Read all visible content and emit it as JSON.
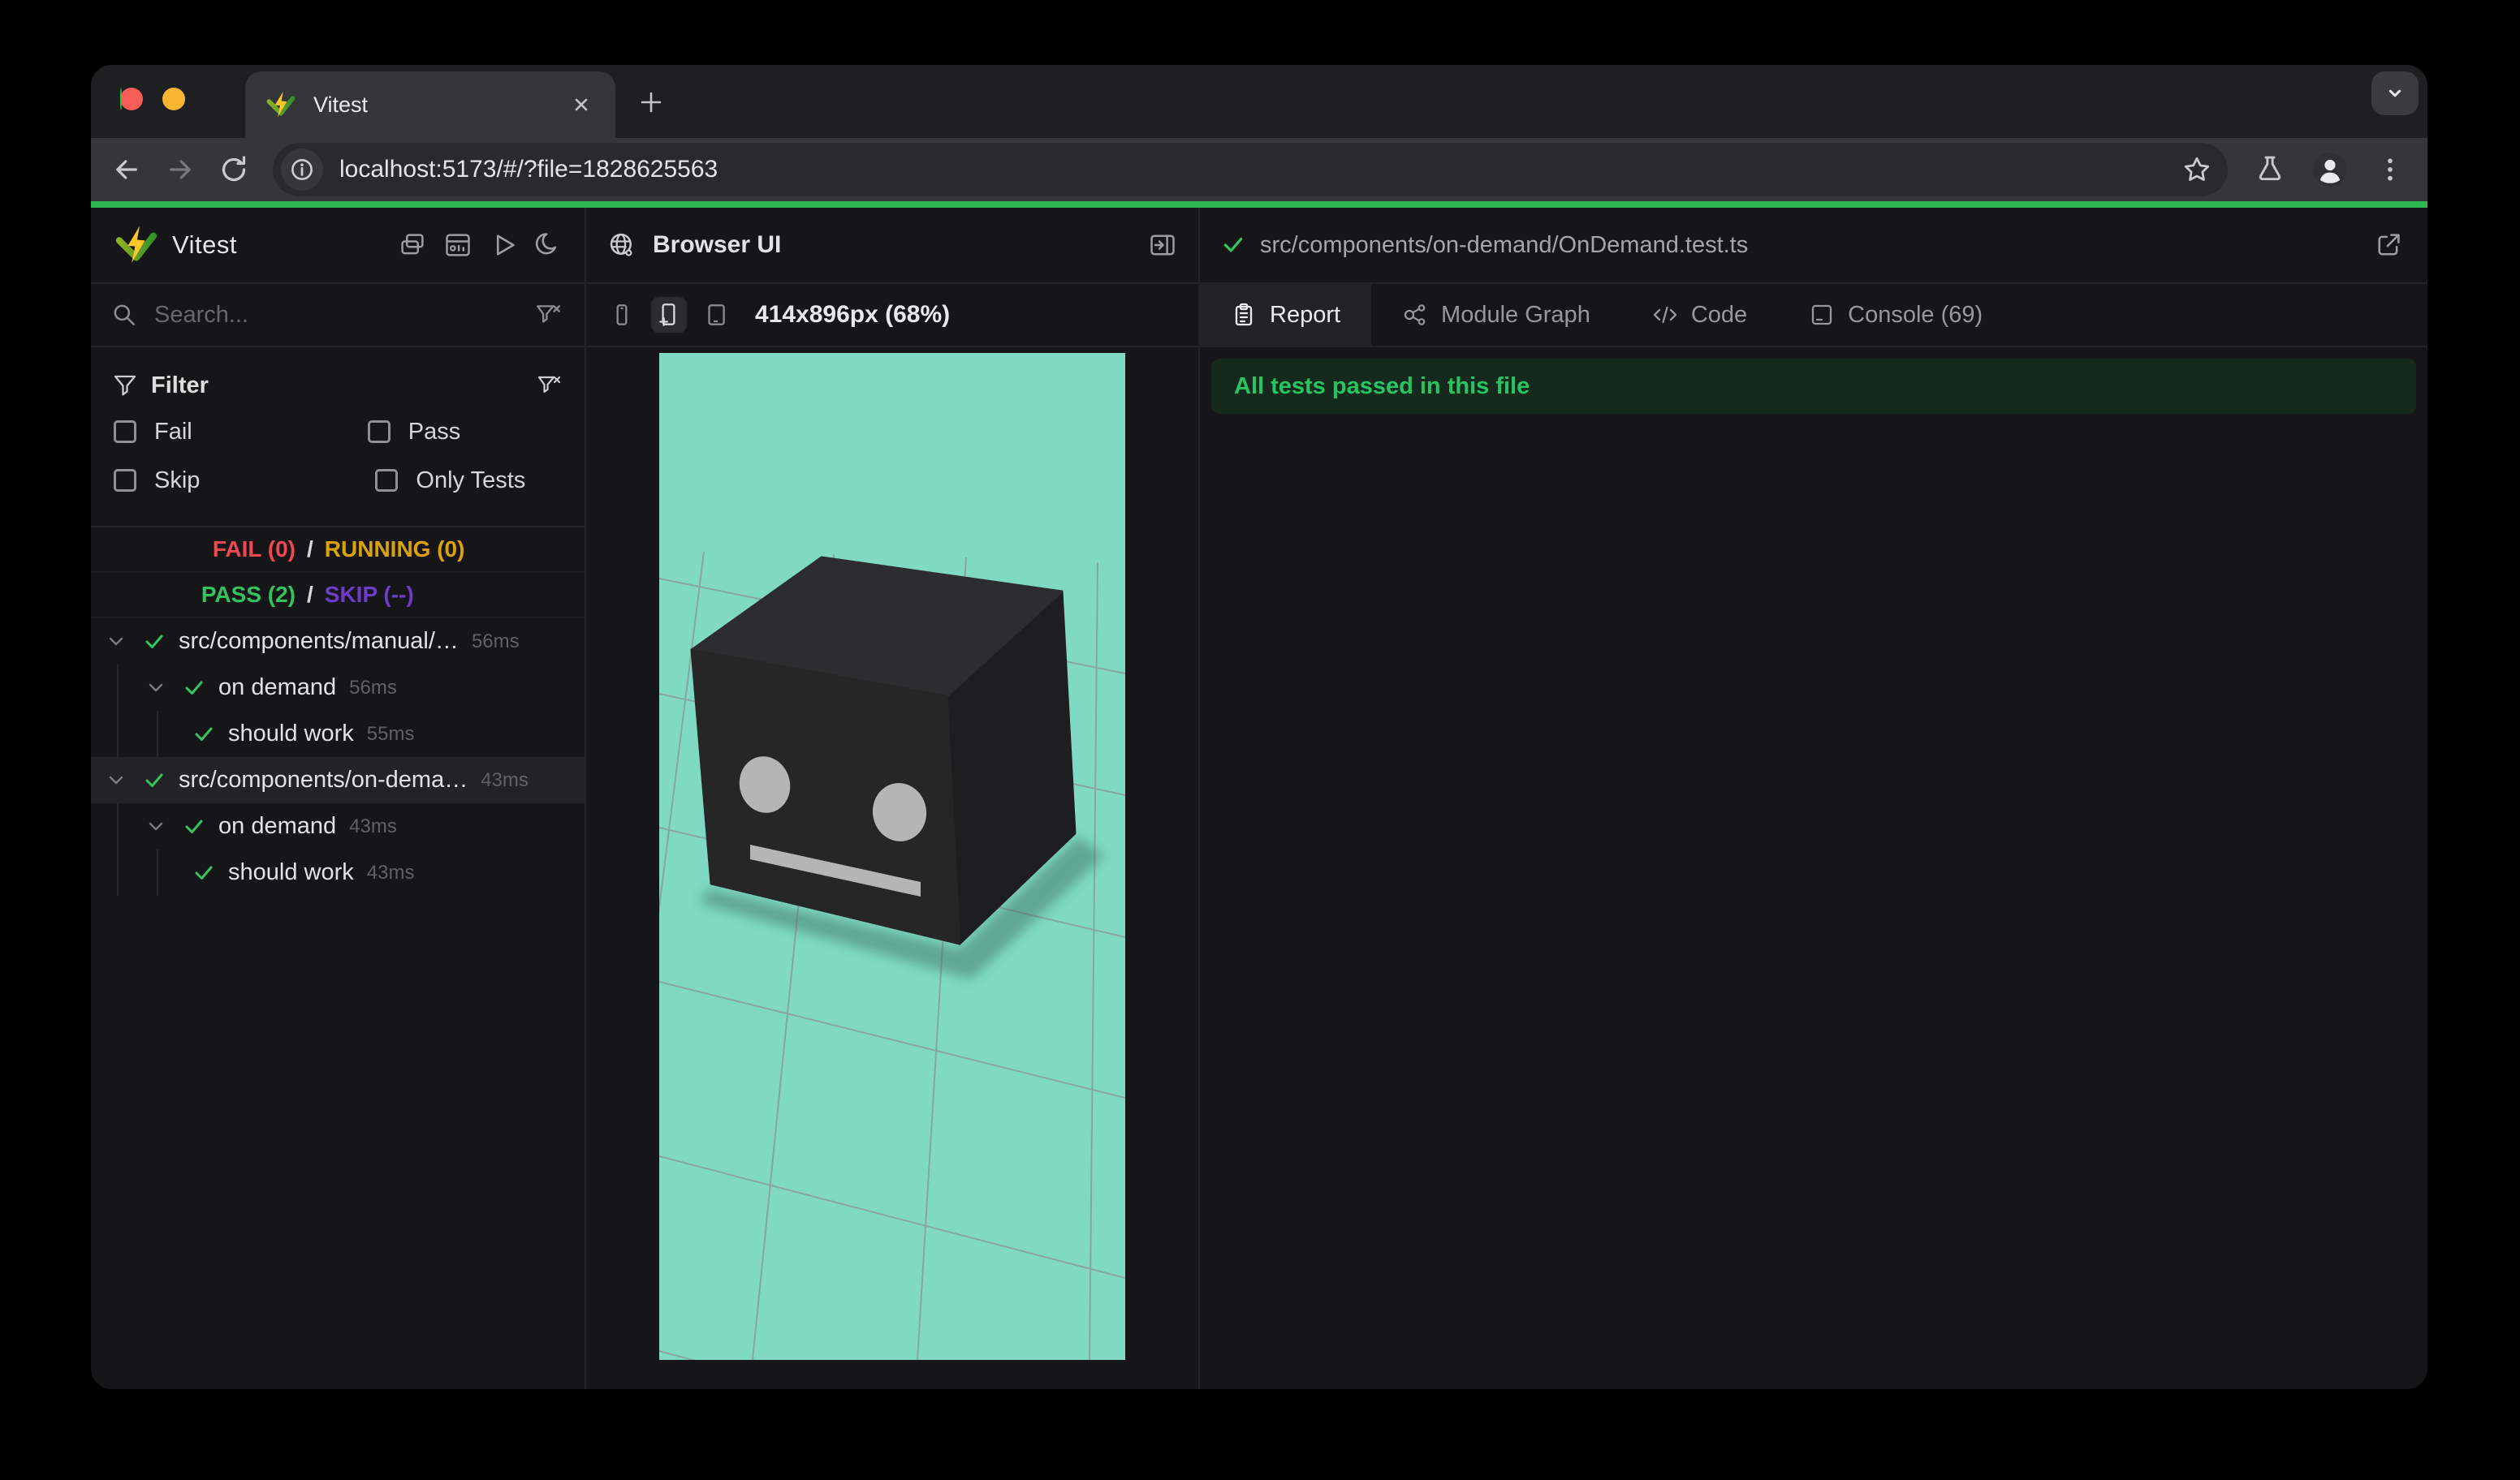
{
  "browser": {
    "tab_title": "Vitest",
    "url": "localhost:5173/#/?file=1828625563"
  },
  "sidebar": {
    "app_name": "Vitest",
    "search_placeholder": "Search...",
    "filter_title": "Filter",
    "filters": [
      "Fail",
      "Pass",
      "Skip",
      "Only Tests"
    ],
    "summary": {
      "fail": "FAIL (0)",
      "running": "RUNNING (0)",
      "pass": "PASS (2)",
      "skip": "SKIP (--)"
    },
    "tree": [
      {
        "label": "src/components/manual/…",
        "time": "56ms"
      },
      {
        "label": "on demand",
        "time": "56ms"
      },
      {
        "label": "should work",
        "time": "55ms"
      },
      {
        "label": "src/components/on-dema…",
        "time": "43ms"
      },
      {
        "label": "on demand",
        "time": "43ms"
      },
      {
        "label": "should work",
        "time": "43ms"
      }
    ]
  },
  "preview": {
    "panel_title": "Browser UI",
    "viewport_label": "414x896px (68%)"
  },
  "report": {
    "file_path": "src/components/on-demand/OnDemand.test.ts",
    "tabs": {
      "report": "Report",
      "module_graph": "Module Graph",
      "code": "Code",
      "console": "Console (69)"
    },
    "banner": "All tests passed in this file"
  },
  "colors": {
    "accent_green": "#2cb84e",
    "pass_green": "#32c35c",
    "fail_red": "#f0484f",
    "running_amber": "#dba309",
    "skip_purple": "#6e3cc9",
    "preview_teal": "#7fdac1"
  }
}
